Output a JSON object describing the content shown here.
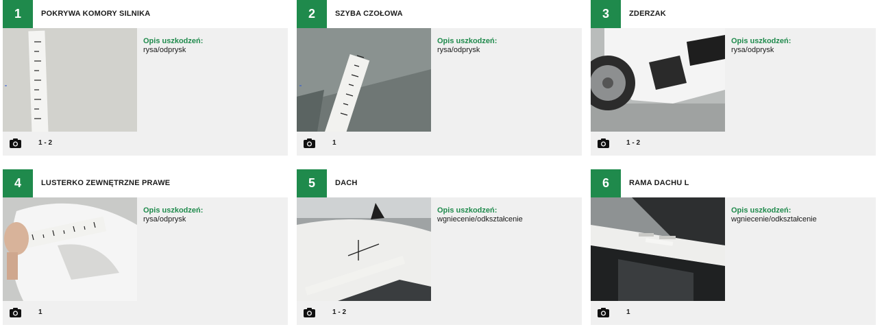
{
  "items": [
    {
      "number": "1",
      "title": "POKRYWA KOMORY SILNIKA",
      "desc_label": "Opis uszkodzeń:",
      "desc_value": "rysa/odprysk",
      "photos": "1 - 2",
      "photo_icon": "camera-icon"
    },
    {
      "number": "2",
      "title": "SZYBA CZOŁOWA",
      "desc_label": "Opis uszkodzeń:",
      "desc_value": "rysa/odprysk",
      "photos": "1",
      "photo_icon": "camera-icon"
    },
    {
      "number": "3",
      "title": "ZDERZAK",
      "desc_label": "Opis uszkodzeń:",
      "desc_value": "rysa/odprysk",
      "photos": "1 - 2",
      "photo_icon": "camera-icon"
    },
    {
      "number": "4",
      "title": "LUSTERKO ZEWNĘTRZNE PRAWE",
      "desc_label": "Opis uszkodzeń:",
      "desc_value": "rysa/odprysk",
      "photos": "1",
      "photo_icon": "camera-icon"
    },
    {
      "number": "5",
      "title": "DACH",
      "desc_label": "Opis uszkodzeń:",
      "desc_value": "wgniecenie/odkształcenie",
      "photos": "1 - 2",
      "photo_icon": "camera-icon"
    },
    {
      "number": "6",
      "title": "RAMA DACHU L",
      "desc_label": "Opis uszkodzeń:",
      "desc_value": "wgniecenie/odkształcenie",
      "photos": "1",
      "photo_icon": "camera-icon"
    }
  ],
  "colors": {
    "accent": "#1f8a4c",
    "panel": "#f0f0f0",
    "text": "#1a1a1a"
  }
}
